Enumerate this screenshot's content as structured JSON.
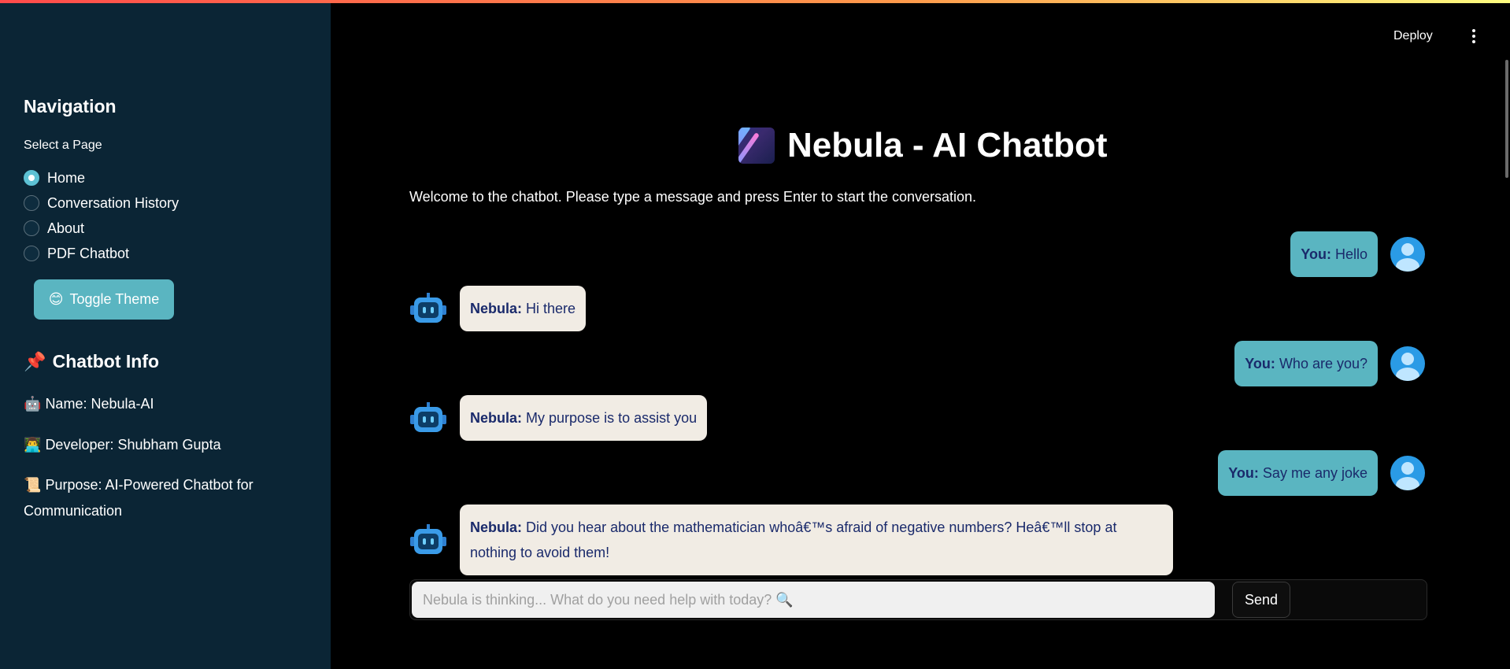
{
  "header": {
    "deploy_label": "Deploy",
    "menu_icon": "vertical-dots-icon"
  },
  "sidebar": {
    "nav_title": "Navigation",
    "select_label": "Select a Page",
    "pages": [
      {
        "label": "Home",
        "selected": true
      },
      {
        "label": "Conversation History",
        "selected": false
      },
      {
        "label": "About",
        "selected": false
      },
      {
        "label": "PDF Chatbot",
        "selected": false
      }
    ],
    "toggle_theme": {
      "icon": "😊",
      "label": "Toggle Theme"
    },
    "info": {
      "title_icon": "📌",
      "title": "Chatbot Info",
      "name_icon": "🤖",
      "name": "Name: Nebula-AI",
      "developer_icon": "👨‍💻",
      "developer": "Developer: Shubham Gupta",
      "purpose_icon": "📜",
      "purpose": "Purpose: AI-Powered Chatbot for Communication"
    }
  },
  "main": {
    "title": "Nebula - AI Chatbot",
    "welcome": "Welcome to the chatbot. Please type a message and press Enter to start the conversation.",
    "messages": [
      {
        "role": "user",
        "speaker": "You:",
        "text": "Hello"
      },
      {
        "role": "bot",
        "speaker": "Nebula:",
        "text": "Hi there"
      },
      {
        "role": "user",
        "speaker": "You:",
        "text": "Who are you?"
      },
      {
        "role": "bot",
        "speaker": "Nebula:",
        "text": "My purpose is to assist you"
      },
      {
        "role": "user",
        "speaker": "You:",
        "text": "Say me any joke"
      },
      {
        "role": "bot",
        "speaker": "Nebula:",
        "text": "Did you hear about the mathematician whoâ€™s afraid of negative numbers? Heâ€™ll stop at nothing to avoid them!"
      }
    ],
    "input": {
      "placeholder": "Nebula is thinking... What do you need help with today? 🔍",
      "value": ""
    },
    "send_label": "Send"
  },
  "colors": {
    "sidebar_bg": "#0b2535",
    "accent": "#5ab5c1",
    "bot_bubble": "#f1ece4",
    "text_dark": "#1a2a6b"
  }
}
